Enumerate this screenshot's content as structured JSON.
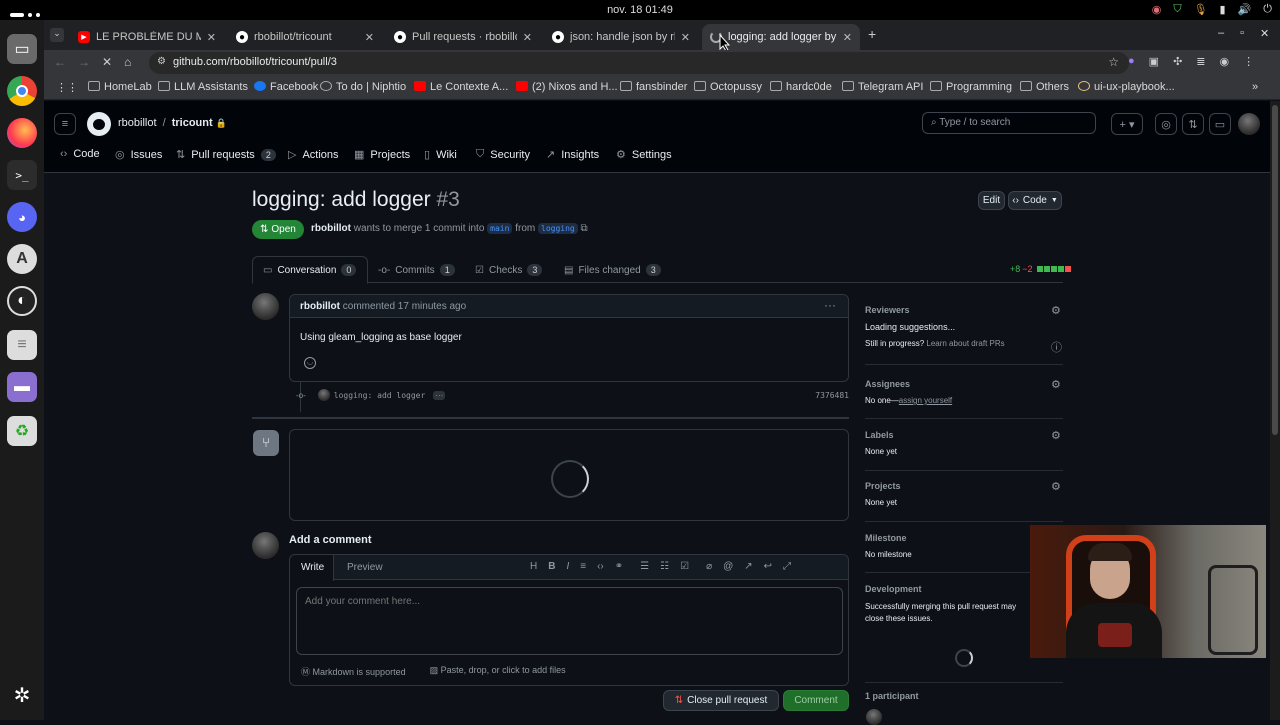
{
  "os": {
    "clock": "nov. 18  01:49"
  },
  "tabs": [
    {
      "title": "LE PROBLÈME DU MULTI",
      "icon": "youtube-icon"
    },
    {
      "title": "rbobillot/tricount",
      "icon": "github-icon"
    },
    {
      "title": "Pull requests · rbobillot/t",
      "icon": "github-icon"
    },
    {
      "title": "json: handle json by rbot",
      "icon": "github-icon"
    },
    {
      "title": "logging: add logger by rb",
      "icon": "loading-icon"
    }
  ],
  "url": "github.com/rbobillot/tricount/pull/3",
  "bookmarks": [
    "HomeLab",
    "LLM Assistants",
    "Facebook",
    "To do | Niphtio",
    "Le Contexte A...",
    "(2) Nixos and H...",
    "fansbinder",
    "Octopussy",
    "hardc0de",
    "Telegram API",
    "Programming",
    "Others",
    "ui-ux-playbook..."
  ],
  "repo": {
    "owner": "rbobillot",
    "sep": "/",
    "name": "tricount"
  },
  "search_placeholder": "Type / to search",
  "nav": [
    {
      "label": "Code",
      "icon": "‹›"
    },
    {
      "label": "Issues",
      "icon": "◎"
    },
    {
      "label": "Pull requests",
      "icon": "⇅",
      "count": "2"
    },
    {
      "label": "Actions",
      "icon": "▷"
    },
    {
      "label": "Projects",
      "icon": "▦"
    },
    {
      "label": "Wiki",
      "icon": "▯"
    },
    {
      "label": "Security",
      "icon": "⛉"
    },
    {
      "label": "Insights",
      "icon": "↗"
    },
    {
      "label": "Settings",
      "icon": "⚙"
    }
  ],
  "pr": {
    "title": "logging: add logger",
    "number": "#3",
    "edit_label": "Edit",
    "code_label": "Code",
    "status": "Open",
    "author": "rbobillot",
    "merge_text": "wants to merge 1 commit into",
    "base_branch": "main",
    "from_text": "from",
    "head_branch": "logging",
    "diffstat_add": "+8",
    "diffstat_del": "−2"
  },
  "pr_tabs": [
    {
      "label": "Conversation",
      "count": "0"
    },
    {
      "label": "Commits",
      "count": "1"
    },
    {
      "label": "Checks",
      "count": "3"
    },
    {
      "label": "Files changed",
      "count": "3"
    }
  ],
  "comment": {
    "author": "rbobillot",
    "meta": "commented 17 minutes ago",
    "body": "Using gleam_logging as base logger"
  },
  "commit": {
    "message": "logging: add logger",
    "sha": "7376481"
  },
  "add_comment": {
    "heading": "Add a comment",
    "write_tab": "Write",
    "preview_tab": "Preview",
    "placeholder": "Add your comment here...",
    "markdown_note": "Markdown is supported",
    "attach_note": "Paste, drop, or click to add files",
    "close_button": "Close pull request",
    "comment_button": "Comment"
  },
  "sidebar": {
    "reviewers": {
      "heading": "Reviewers",
      "line1": "Loading suggestions...",
      "line2": "Still in progress?",
      "link": "Learn about draft PRs"
    },
    "assignees": {
      "heading": "Assignees",
      "value": "No one—",
      "link": "assign yourself"
    },
    "labels": {
      "heading": "Labels",
      "value": "None yet"
    },
    "projects": {
      "heading": "Projects",
      "value": "None yet"
    },
    "milestone": {
      "heading": "Milestone",
      "value": "No milestone"
    },
    "development": {
      "heading": "Development",
      "value": "Successfully merging this pull request may close these issues."
    },
    "participants": {
      "heading": "1 participant"
    }
  },
  "colors": {
    "open_green": "#238636",
    "link_blue": "#4493f8",
    "danger": "#f85149"
  }
}
